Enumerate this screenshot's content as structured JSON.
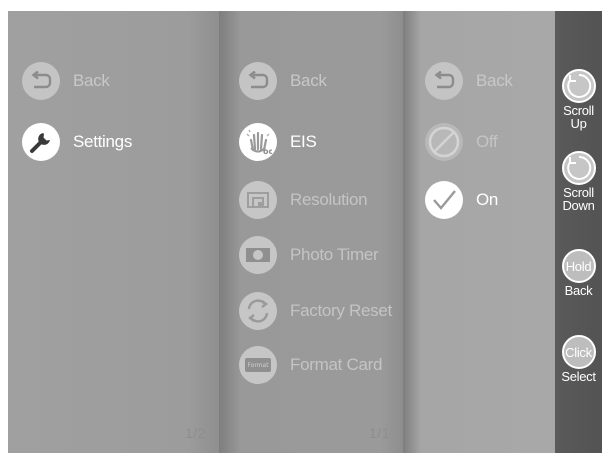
{
  "menu_level_1": {
    "items": [
      {
        "label": "Back",
        "icon": "back-arrow-icon",
        "state": "dim"
      },
      {
        "label": "Settings",
        "icon": "wrench-icon",
        "state": "active"
      }
    ],
    "page_indicator": "1/2"
  },
  "menu_level_2": {
    "items": [
      {
        "label": "Back",
        "icon": "back-arrow-icon",
        "state": "dim"
      },
      {
        "label": "EIS",
        "icon": "shaking-hand-icon",
        "state": "active"
      },
      {
        "label": "Resolution",
        "icon": "resolution-icon",
        "state": "faint"
      },
      {
        "label": "Photo Timer",
        "icon": "photo-timer-icon",
        "state": "faint"
      },
      {
        "label": "Factory Reset",
        "icon": "factory-reset-icon",
        "state": "faint"
      },
      {
        "label": "Format Card",
        "icon": "format-card-icon",
        "state": "faint",
        "icon_text": "Format"
      }
    ],
    "page_indicator": "1/1"
  },
  "menu_level_3": {
    "items": [
      {
        "label": "Back",
        "icon": "back-arrow-icon",
        "state": "dim"
      },
      {
        "label": "Off",
        "icon": "off-slash-icon",
        "state": "faint"
      },
      {
        "label": "On",
        "icon": "checkmark-icon",
        "state": "active"
      }
    ]
  },
  "controls": {
    "scroll_up": {
      "label_line1": "Scroll",
      "label_line2": "Up",
      "icon": "rotate-arrow-icon"
    },
    "scroll_down": {
      "label_line1": "Scroll",
      "label_line2": "Down",
      "icon": "rotate-arrow-icon"
    },
    "hold_back": {
      "circle_text": "Hold",
      "label": "Back"
    },
    "click_select": {
      "circle_text": "Click",
      "label": "Select"
    }
  },
  "colors": {
    "active_text": "#ffffff",
    "dim_text": "#c8c8c8",
    "side_bar": "#545454"
  }
}
